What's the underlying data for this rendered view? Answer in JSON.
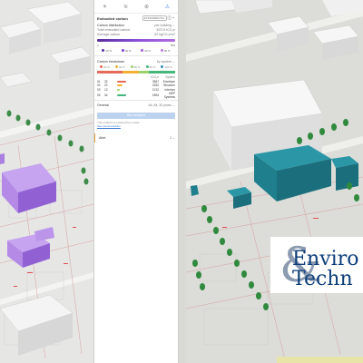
{
  "panel": {
    "embodied": {
      "title": "Embodied carbon",
      "mode_badge": "EXPERIMENTAL",
      "distribution_label": "Carbon distribution",
      "distribution_unit": "per building",
      "rows": [
        {
          "label": "Total embodied carbon",
          "value": "30374 tCO₂e"
        },
        {
          "label": "Average carbon",
          "value": "62 kgCO₂e/m²"
        }
      ],
      "gradient_min": "0",
      "gradient_max": "800"
    },
    "legend": [
      "20 %",
      "40 %",
      "60 %",
      "80 %"
    ],
    "breakdown": {
      "title": "Carbon breakdown",
      "group_by": "by system",
      "legend": [
        "20 %",
        "40 %",
        "60 %",
        "80 %",
        "100 %"
      ],
      "header": [
        "",
        "",
        "tCO₂e",
        "System"
      ],
      "rows": [
        {
          "id": "01",
          "pct": "32",
          "value": "3557",
          "system": "Envelope",
          "color": "#e46a5a",
          "fill": 0.35
        },
        {
          "id": "02",
          "pct": "22",
          "value": "2252",
          "system": "Structure",
          "color": "#f2b134",
          "fill": 0.22
        },
        {
          "id": "03",
          "pct": "12",
          "value": "1212",
          "system": "Interiors",
          "color": "#9bd26a",
          "fill": 0.12
        },
        {
          "id": "04",
          "pct": "34",
          "value": "1894",
          "system": "MEP Systems",
          "color": "#43b87a",
          "fill": 0.34
        }
      ]
    },
    "general": {
      "label": "General",
      "value": "All, All, 30 years"
    },
    "run_button": "Run analysis",
    "note": "This analysis is powered by Locale.",
    "note_link": "See documentation",
    "alert": {
      "label": "Alert",
      "count": "3"
    }
  },
  "logo": {
    "line1": "Enviro",
    "line2": "Techn",
    "amp": "&"
  },
  "colors": {
    "purple_building": "#a97fe0",
    "teal_building": "#1f7f8c",
    "tree": "#3d8c4a",
    "accent": "#3a7bd5"
  }
}
